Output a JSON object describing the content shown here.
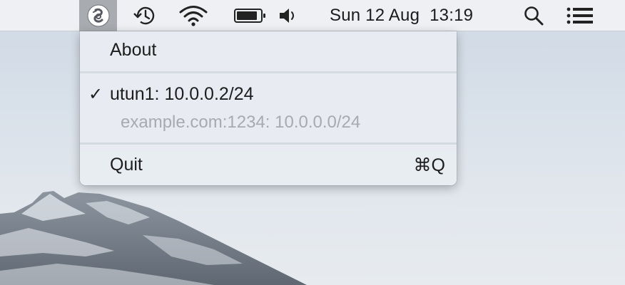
{
  "menubar": {
    "app_icon": "wireguard-icon",
    "icons": [
      "time-machine-icon",
      "wifi-icon",
      "battery-icon",
      "volume-icon",
      "spotlight-search-icon",
      "notification-center-icon"
    ],
    "date": "Sun 12 Aug",
    "time": "13:19"
  },
  "menu": {
    "about_label": "About",
    "interface": {
      "checked": true,
      "check_glyph": "✓",
      "label": "utun1: 10.0.0.2/24"
    },
    "peer_label": "example.com:1234: 10.0.0.0/24",
    "quit_label": "Quit",
    "quit_shortcut": "⌘Q"
  },
  "colors": {
    "menubar_bg": "#eef0f3",
    "menu_bg": "#e8ecf2",
    "disabled_text": "#a7abb1",
    "highlight_app_icon_bg": "#a8acb1"
  }
}
